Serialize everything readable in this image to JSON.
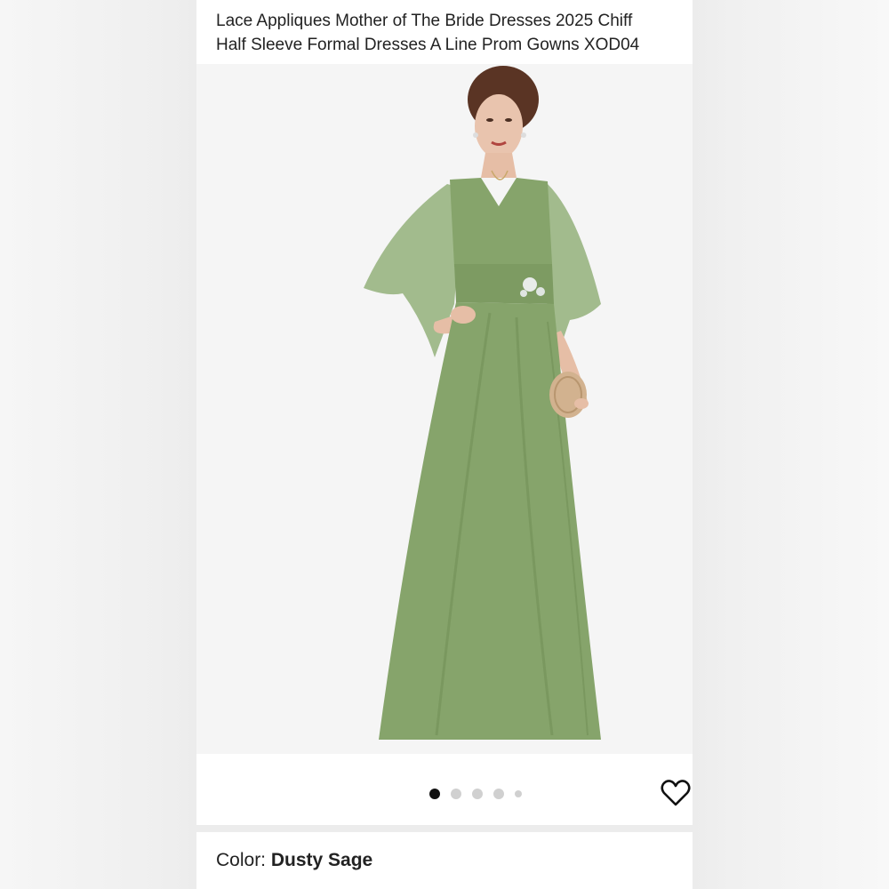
{
  "product": {
    "title_line_1": "Lace Appliques Mother of The Bride Dresses 2025 Chiff",
    "title_line_2": "Half Sleeve Formal Dresses A Line Prom Gowns XOD04"
  },
  "carousel": {
    "image_count": 5,
    "active_index": 0,
    "favorite_icon": "heart-outline-icon"
  },
  "selection": {
    "color_label": "Color: ",
    "color_value": "Dusty Sage"
  },
  "colors": {
    "dress": "#86a46b",
    "accent": "#111111"
  }
}
